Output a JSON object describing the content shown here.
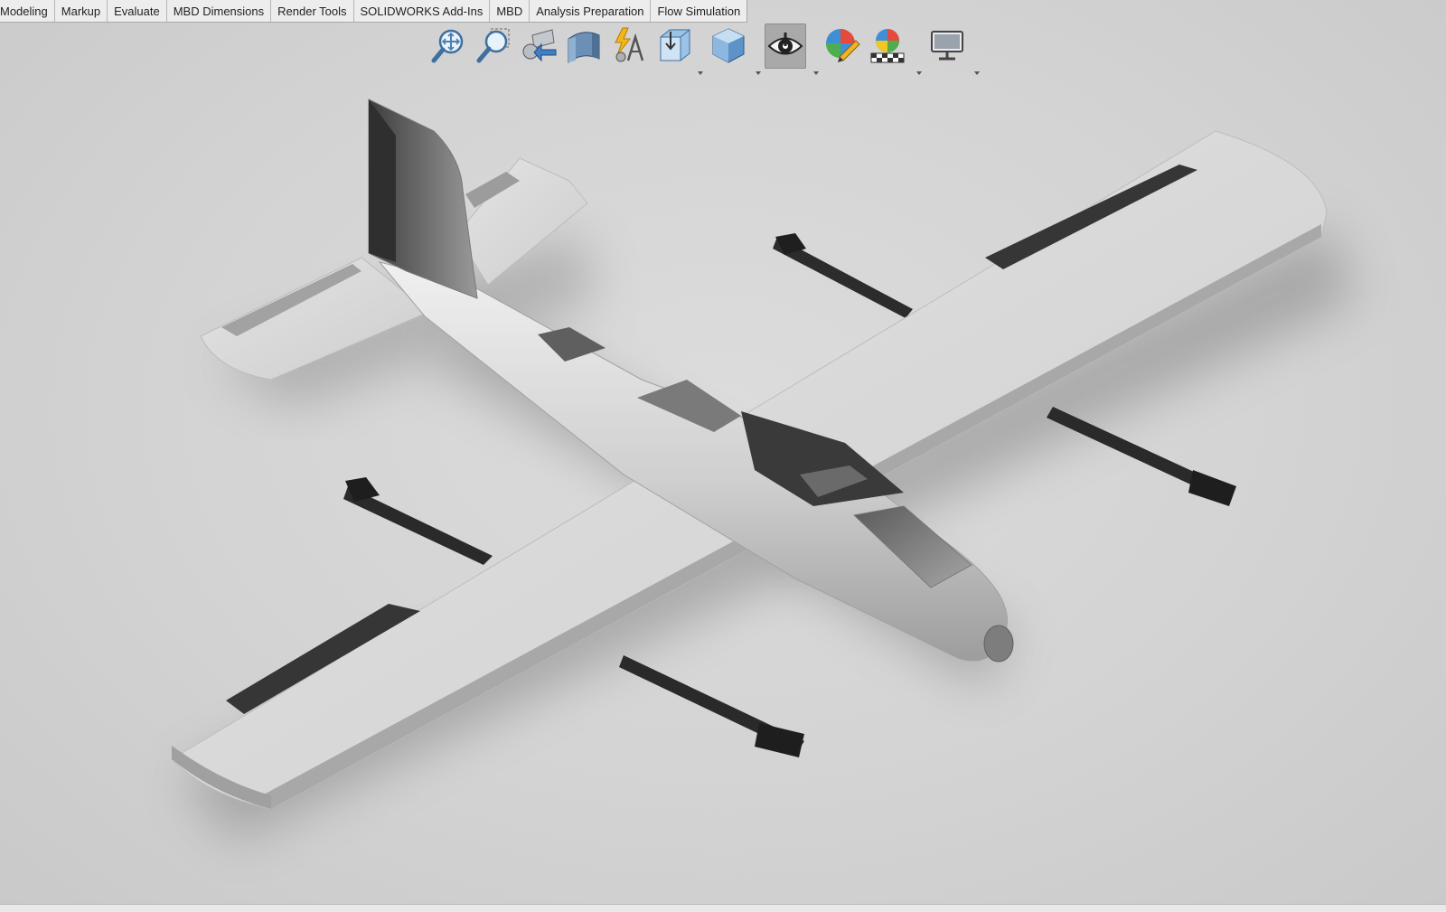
{
  "command_manager": {
    "tabs": [
      {
        "label": "Modeling"
      },
      {
        "label": "Markup"
      },
      {
        "label": "Evaluate"
      },
      {
        "label": "MBD Dimensions"
      },
      {
        "label": "Render Tools"
      },
      {
        "label": "SOLIDWORKS Add-Ins"
      },
      {
        "label": "MBD"
      },
      {
        "label": "Analysis Preparation"
      },
      {
        "label": "Flow Simulation"
      }
    ]
  },
  "heads_up_toolbar": {
    "tools": [
      {
        "icon": "zoom-to-fit-icon"
      },
      {
        "icon": "zoom-to-area-icon"
      },
      {
        "icon": "previous-view-icon"
      },
      {
        "icon": "section-view-icon"
      },
      {
        "icon": "dynamic-annotation-views-icon"
      },
      {
        "icon": "view-orientation-icon",
        "has_dropdown": true
      },
      {
        "icon": "display-style-icon",
        "has_dropdown": true
      },
      {
        "icon": "hide-show-items-icon",
        "has_dropdown": true,
        "active": true
      },
      {
        "icon": "edit-appearance-icon"
      },
      {
        "icon": "apply-scene-icon",
        "has_dropdown": true
      },
      {
        "icon": "view-settings-icon",
        "has_dropdown": true
      }
    ]
  },
  "graphics_area": {
    "model": "fixed-wing-vtol-drone",
    "colors": {
      "body": "#d2d2d2",
      "control_surface": "#3a3a3a",
      "boom": "#2c2c2c"
    }
  }
}
